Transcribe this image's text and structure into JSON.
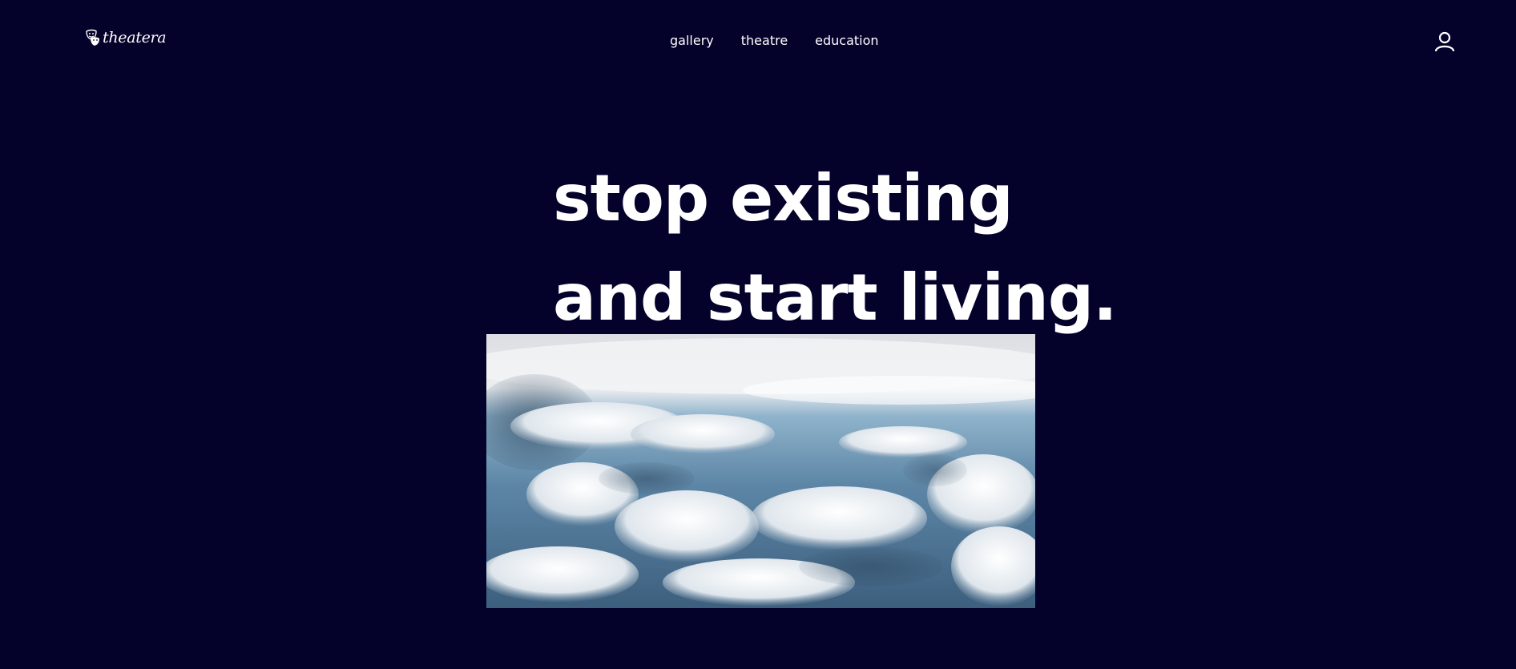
{
  "header": {
    "logo_text": "theatera",
    "logo_icon": "theatre-masks-icon",
    "nav": [
      {
        "label": "gallery"
      },
      {
        "label": "theatre"
      },
      {
        "label": "education"
      }
    ],
    "account_icon": "user-icon"
  },
  "hero": {
    "line1": "stop existing",
    "line2": "and start living.",
    "image_icon": "clouds-photo"
  },
  "colors": {
    "background": "#04012a",
    "text": "#ffffff"
  }
}
